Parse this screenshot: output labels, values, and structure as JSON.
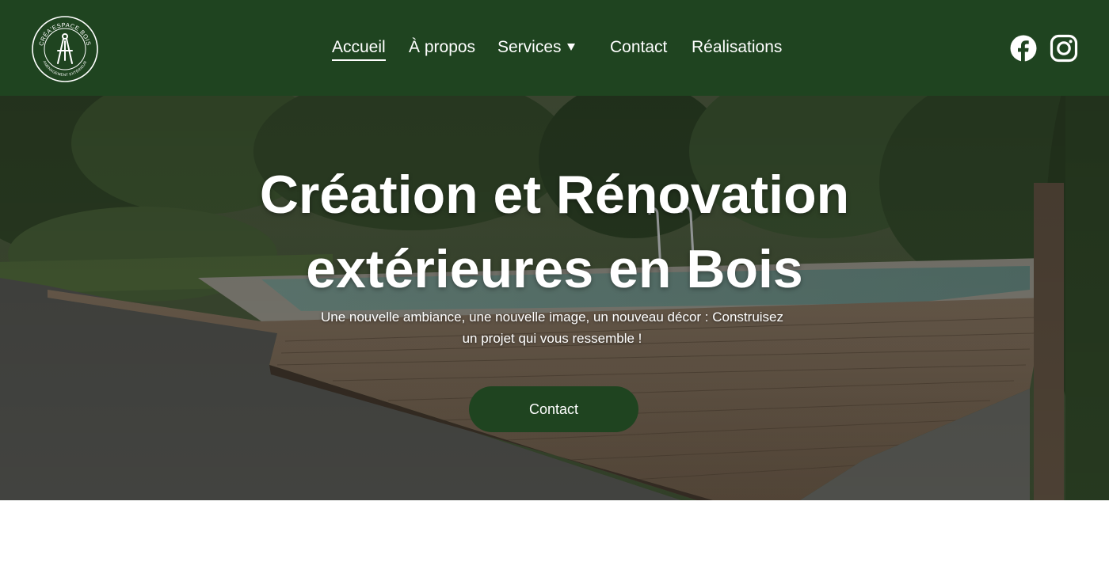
{
  "brand": {
    "logo_text_top": "CRÉA'ESPACE BOIS",
    "logo_text_bottom": "AMÉNAGEMENT EXTÉRIEUR"
  },
  "nav": {
    "items": [
      {
        "label": "Accueil"
      },
      {
        "label": "À propos"
      },
      {
        "label": "Services"
      },
      {
        "label": "Contact"
      },
      {
        "label": "Réalisations"
      }
    ]
  },
  "social": {
    "facebook_icon": "facebook-icon",
    "instagram_icon": "instagram-icon"
  },
  "hero": {
    "title_line1": "Création et Rénovation",
    "title_line2": "extérieures en Bois",
    "subtitle_line1": "Une nouvelle ambiance, une nouvelle image, un nouveau décor : Construisez",
    "subtitle_line2": "un projet qui vous ressemble !",
    "button_label": "Contact"
  },
  "colors": {
    "header_bg": "#1f4420",
    "button_bg": "#1f4420",
    "text": "#ffffff"
  }
}
